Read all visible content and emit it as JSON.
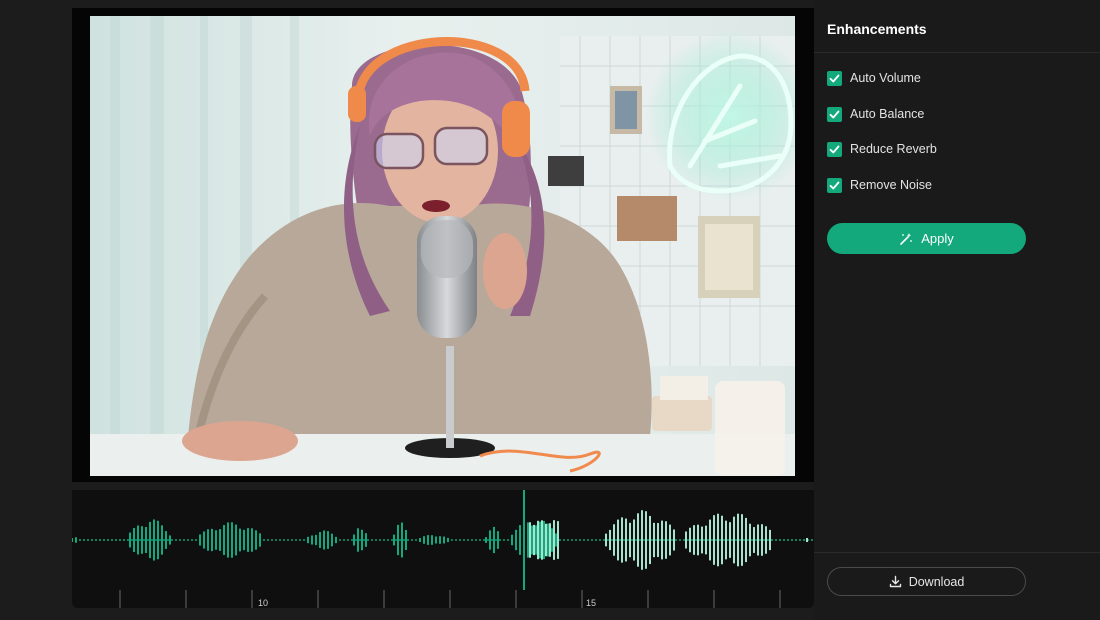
{
  "panel": {
    "title": "Enhancements",
    "options": [
      {
        "label": "Auto Volume",
        "checked": true
      },
      {
        "label": "Auto Balance",
        "checked": true
      },
      {
        "label": "Reduce Reverb",
        "checked": true
      },
      {
        "label": "Remove Noise",
        "checked": true
      }
    ],
    "apply_label": "Apply",
    "apply_icon": "magic-wand-icon",
    "download_label": "Download",
    "download_icon": "download-icon"
  },
  "timeline": {
    "ruler_labels": [
      "10",
      "15"
    ],
    "waveform_color": "#14a97c",
    "processed_color": "#a9e3cf",
    "playhead_color": "#14a97c"
  },
  "colors": {
    "accent": "#14a97c",
    "panel_bg": "#1a1a1a",
    "page_bg": "#1c1c1c"
  }
}
